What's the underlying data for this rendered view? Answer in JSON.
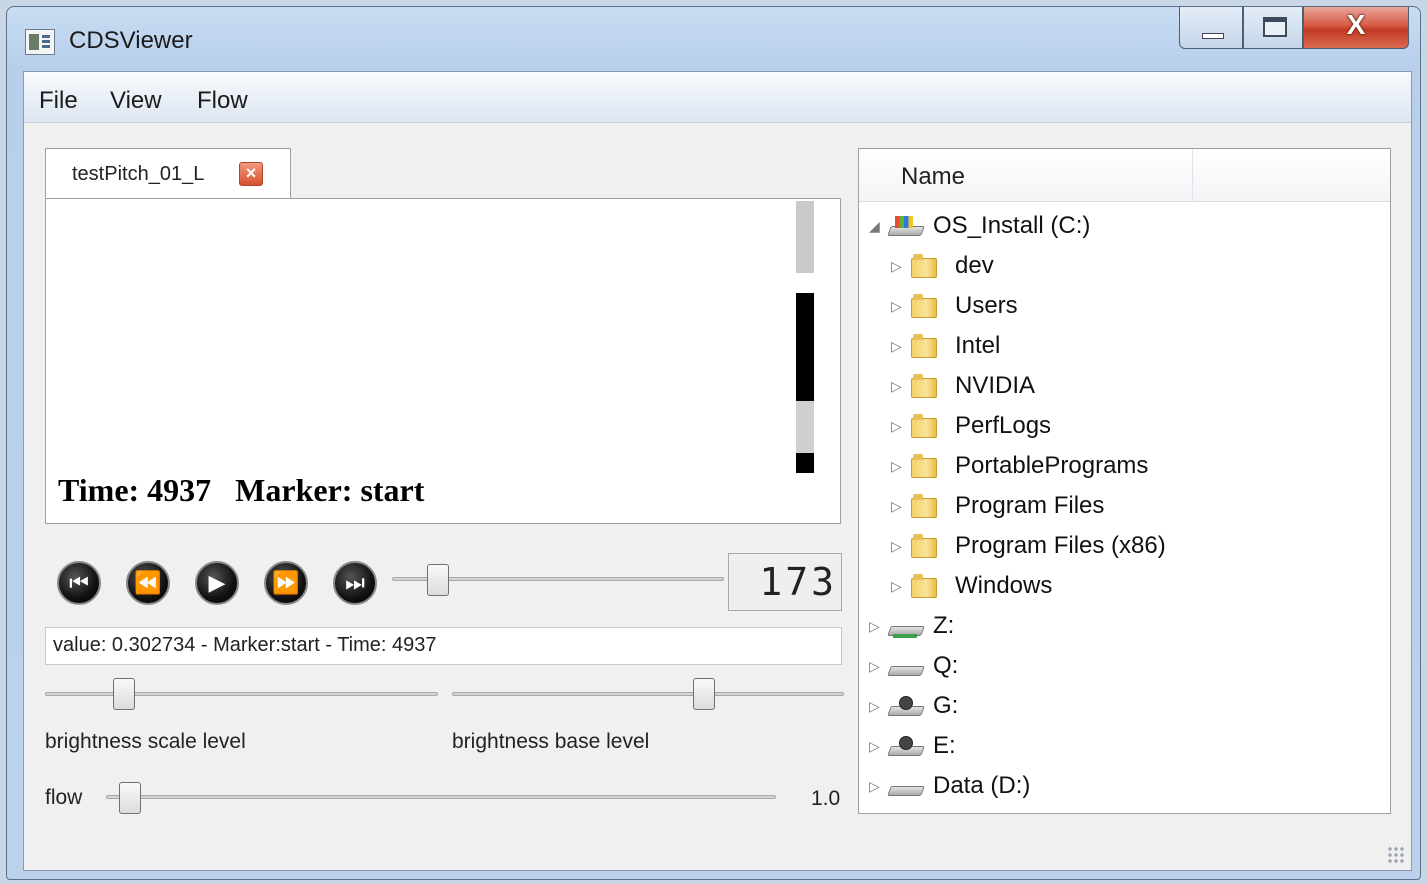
{
  "window": {
    "title": "CDSViewer",
    "controls": {
      "minimize": "–",
      "maximize": "□",
      "close": "X"
    }
  },
  "menu": [
    "File",
    "View",
    "Flow"
  ],
  "tab": {
    "label": "testPitch_01_L",
    "close_glyph": "×"
  },
  "viewer": {
    "time_label": "Time:",
    "time_value": "4937",
    "marker_label": "Marker:",
    "marker_value": "start"
  },
  "playback": {
    "buttons": [
      {
        "name": "skip-to-start-button",
        "glyph": "⏮"
      },
      {
        "name": "rewind-button",
        "glyph": "⏪"
      },
      {
        "name": "play-button",
        "glyph": "▶"
      },
      {
        "name": "fast-forward-button",
        "glyph": "⏩"
      },
      {
        "name": "skip-to-end-button",
        "glyph": "⏭"
      }
    ],
    "position_fraction": 0.04,
    "frame_display": "173"
  },
  "status": "value: 0.302734 - Marker:start - Time: 4937",
  "sliders": {
    "brightness_scale": {
      "label": "brightness scale level",
      "fraction": 0.12
    },
    "brightness_base": {
      "label": "brightness base level",
      "fraction": 0.65
    },
    "flow": {
      "label": "flow",
      "value": "1.0",
      "fraction": 0.02
    }
  },
  "tree": {
    "header": "Name",
    "items": [
      {
        "label": "OS_Install (C:)",
        "icon": "system-drive-icon",
        "expanded": true,
        "depth": 0
      },
      {
        "label": "dev",
        "icon": "folder-icon",
        "depth": 1
      },
      {
        "label": "Users",
        "icon": "folder-icon",
        "depth": 1
      },
      {
        "label": "Intel",
        "icon": "folder-icon",
        "depth": 1
      },
      {
        "label": "NVIDIA",
        "icon": "folder-icon",
        "depth": 1
      },
      {
        "label": "PerfLogs",
        "icon": "folder-icon",
        "depth": 1
      },
      {
        "label": "PortablePrograms",
        "icon": "folder-icon",
        "depth": 1
      },
      {
        "label": "Program Files",
        "icon": "folder-icon",
        "depth": 1
      },
      {
        "label": "Program Files (x86)",
        "icon": "folder-icon",
        "depth": 1
      },
      {
        "label": "Windows",
        "icon": "folder-icon",
        "depth": 1
      },
      {
        "label": "Z:",
        "icon": "network-drive-icon",
        "depth": 0
      },
      {
        "label": "Q:",
        "icon": "drive-icon",
        "depth": 0
      },
      {
        "label": "G:",
        "icon": "optical-drive-icon",
        "depth": 0
      },
      {
        "label": "E:",
        "icon": "optical-drive-icon",
        "depth": 0
      },
      {
        "label": "Data (D:)",
        "icon": "drive-icon",
        "depth": 0
      }
    ]
  }
}
